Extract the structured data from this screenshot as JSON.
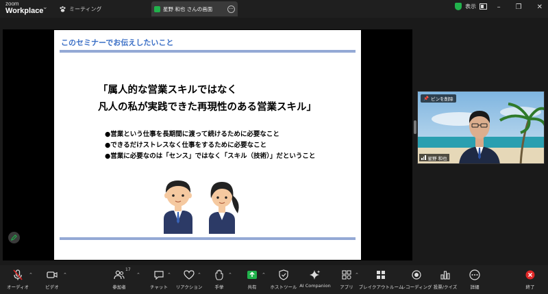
{
  "app": {
    "logo_line1": "zoom",
    "logo_line2": "Workplace"
  },
  "tabs": {
    "meeting_label": "ミーティング",
    "share_label": "星野 和也 さんの画面"
  },
  "titlebar": {
    "view_label": "表示"
  },
  "slide": {
    "heading": "このセミナーでお伝えしたいこと",
    "quote_line1": "「属人的な営業スキルではなく",
    "quote_line2": "凡人の私が実践できた再現性のある営業スキル」",
    "bullets": [
      "●営業という仕事を長期間に渡って続けるために必要なこと",
      "●できるだけストレスなく仕事をするために必要なこと",
      "●営業に必要なのは「センス」ではなく「スキル（技術）」だということ"
    ]
  },
  "video": {
    "pin_label": "ピンを削除",
    "participant_name": "星野 和也"
  },
  "toolbar": {
    "audio": "オーディオ",
    "video": "ビデオ",
    "participants": "参加者",
    "participant_count": "17",
    "chat": "チャット",
    "reactions": "リアクション",
    "raise_hand": "手挙",
    "share": "共有",
    "host_tools": "ホストツール",
    "ai_companion": "AI Companion",
    "apps": "アプリ",
    "breakout": "ブレイクアウトルーム",
    "recording": "レコーディング",
    "polls": "投票/クイズ",
    "more": "詳細",
    "end": "終了"
  },
  "colors": {
    "accent_green": "#21b24c",
    "end_red": "#e02828",
    "slide_heading": "#3b6fc6",
    "slide_rule": "#94a9d5"
  }
}
